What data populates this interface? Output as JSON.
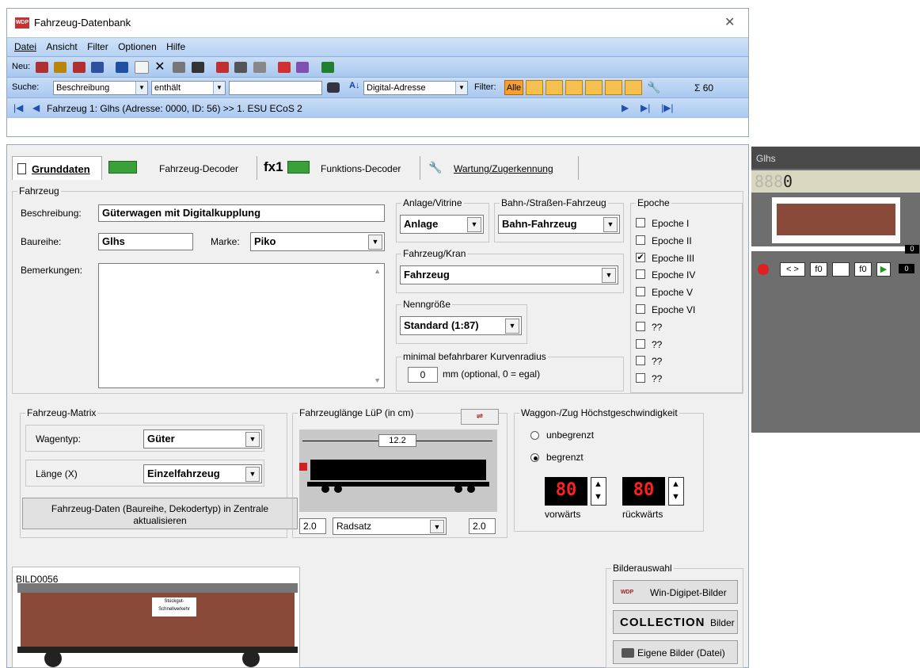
{
  "window": {
    "title": "Fahrzeug-Datenbank",
    "close": "✕"
  },
  "menu": [
    "Datei",
    "Ansicht",
    "Filter",
    "Optionen",
    "Hilfe"
  ],
  "toolbar": {
    "new_label": "Neu:"
  },
  "search": {
    "label": "Suche:",
    "field": "Beschreibung",
    "op": "enthält",
    "value": "",
    "sort": "Digital-Adresse",
    "filter_label": "Filter:",
    "filter_all": "Alle",
    "sum": "Σ 60"
  },
  "nav": {
    "record": "Fahrzeug 1: Glhs (Adresse: 0000, ID: 56) >> 1. ESU ECoS 2"
  },
  "tabs": {
    "t1": "Grunddaten",
    "t2": "Fahrzeug-Decoder",
    "t3_prefix": "fx1",
    "t3": "Funktions-Decoder",
    "t4": "Wartung/Zugerkennung"
  },
  "fahrzeug": {
    "group": "Fahrzeug",
    "beschreibung_label": "Beschreibung:",
    "beschreibung": "Güterwagen mit Digitalkupplung",
    "baureihe_label": "Baureihe:",
    "baureihe": "Glhs",
    "marke_label": "Marke:",
    "marke": "Piko",
    "bemerkungen_label": "Bemerkungen:"
  },
  "anlage": {
    "group": "Anlage/Vitrine",
    "value": "Anlage"
  },
  "bahn": {
    "group": "Bahn-/Straßen-Fahrzeug",
    "value": "Bahn-Fahrzeug"
  },
  "kran": {
    "group": "Fahrzeug/Kran",
    "value": "Fahrzeug"
  },
  "nenn": {
    "group": "Nenngröße",
    "value": "Standard (1:87)"
  },
  "radius": {
    "group": "minimal befahrbarer Kurvenradius",
    "value": "0",
    "unit": "mm (optional, 0 = egal)"
  },
  "epoche": {
    "group": "Epoche",
    "items": [
      {
        "label": "Epoche I",
        "checked": false
      },
      {
        "label": "Epoche II",
        "checked": false
      },
      {
        "label": "Epoche III",
        "checked": true
      },
      {
        "label": "Epoche IV",
        "checked": false
      },
      {
        "label": "Epoche V",
        "checked": false
      },
      {
        "label": "Epoche VI",
        "checked": false
      },
      {
        "label": "??",
        "checked": false
      },
      {
        "label": "??",
        "checked": false
      },
      {
        "label": "??",
        "checked": false
      },
      {
        "label": "??",
        "checked": false
      }
    ]
  },
  "matrix": {
    "group": "Fahrzeug-Matrix",
    "wagentyp_label": "Wagentyp:",
    "wagentyp": "Güter",
    "laenge_label": "Länge (X)",
    "laenge": "Einzelfahrzeug",
    "update_btn": "Fahrzeug-Daten (Baureihe, Dekodertyp) in Zentrale aktualisieren"
  },
  "laenge": {
    "group": "Fahrzeuglänge LüP (in cm)",
    "total": "12.2",
    "left": "2.0",
    "right": "2.0",
    "radsatz": "Radsatz"
  },
  "speed": {
    "group": "Waggon-/Zug Höchstgeschwindigkeit",
    "unbegrenzt": "unbegrenzt",
    "begrenzt": "begrenzt",
    "fwd": "80",
    "bwd": "80",
    "fwd_label": "vorwärts",
    "bwd_label": "rückwärts"
  },
  "image": {
    "label": "BILD0056",
    "plate": "Stückgut-Schnellverkehr"
  },
  "bilder": {
    "group": "Bilderauswahl",
    "b1": "Win-Digipet-Bilder",
    "b2_logo": "COLLECTION",
    "b2": "Bilder",
    "b3": "Eigene Bilder (Datei)"
  },
  "side": {
    "title": "Glhs",
    "digits": "888",
    "speed0": "0",
    "fn1": "f0",
    "fn2": "f0",
    "val1": "0",
    "val2": "0"
  }
}
